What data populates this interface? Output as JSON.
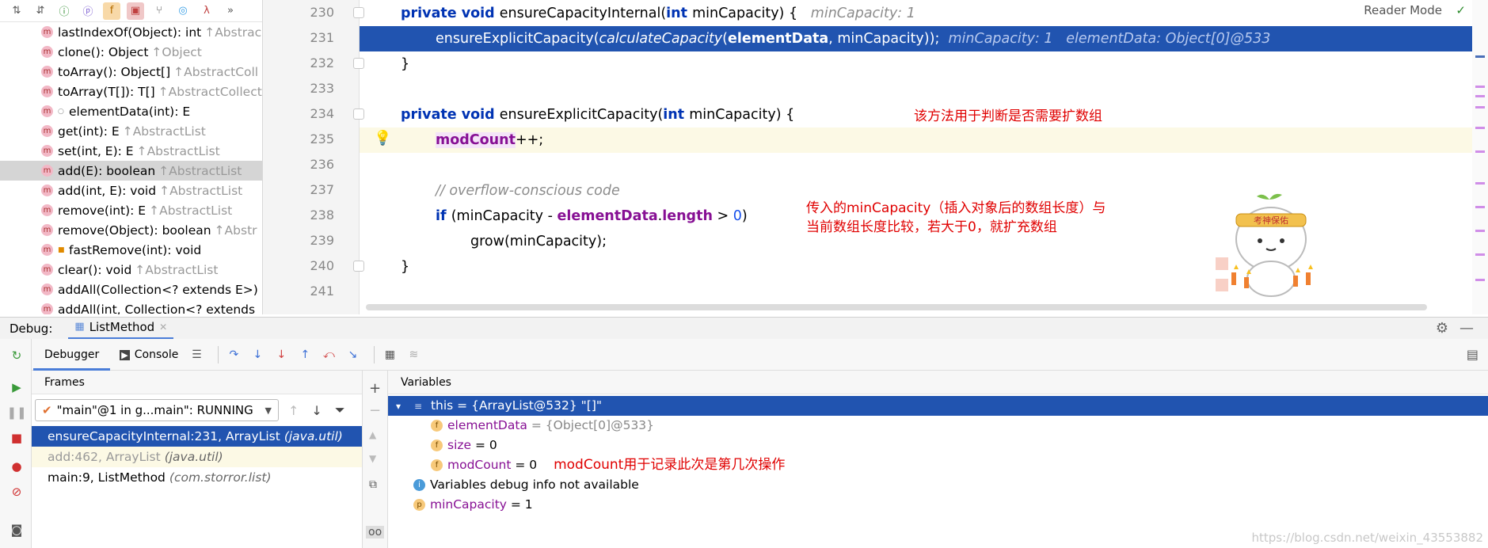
{
  "structure": {
    "items": [
      {
        "name": "lastIndexOf(Object): int",
        "owner": "↑Abstrac",
        "vis": ""
      },
      {
        "name": "clone(): Object",
        "owner": "↑Object",
        "vis": ""
      },
      {
        "name": "toArray(): Object[]",
        "owner": "↑AbstractColl",
        "vis": ""
      },
      {
        "name": "toArray(T[]): T[]",
        "owner": "↑AbstractCollect",
        "vis": ""
      },
      {
        "name": "elementData(int): E",
        "owner": "",
        "vis": "○"
      },
      {
        "name": "get(int): E",
        "owner": "↑AbstractList",
        "vis": ""
      },
      {
        "name": "set(int, E): E",
        "owner": "↑AbstractList",
        "vis": ""
      },
      {
        "name": "add(E): boolean",
        "owner": "↑AbstractList",
        "vis": ""
      },
      {
        "name": "add(int, E): void",
        "owner": "↑AbstractList",
        "vis": ""
      },
      {
        "name": "remove(int): E",
        "owner": "↑AbstractList",
        "vis": ""
      },
      {
        "name": "remove(Object): boolean",
        "owner": "↑Abstr",
        "vis": ""
      },
      {
        "name": "fastRemove(int): void",
        "owner": "",
        "vis": "🔒"
      },
      {
        "name": "clear(): void",
        "owner": "↑AbstractList",
        "vis": ""
      },
      {
        "name": "addAll(Collection<? extends E>)",
        "owner": "",
        "vis": ""
      },
      {
        "name": "addAll(int, Collection<? extends",
        "owner": "",
        "vis": ""
      }
    ]
  },
  "editor": {
    "reader_mode": "Reader Mode",
    "line_numbers": [
      "230",
      "231",
      "232",
      "233",
      "234",
      "235",
      "236",
      "237",
      "238",
      "239",
      "240",
      "241"
    ],
    "l230_hint": "minCapacity: 1",
    "l231_hint1": "minCapacity: 1",
    "l231_hint2": "elementData: Object[0]@533",
    "comment": "// overflow-conscious code",
    "annot1": "该方法用于判断是否需要扩数组",
    "annot2a": "传入的minCapacity（插入对象后的数组长度）与",
    "annot2b": "当前数组长度比较，若大于0，就扩充数组",
    "mascot_text": "考神保佑"
  },
  "debug": {
    "label": "Debug:",
    "tab": "ListMethod",
    "debugger_tab": "Debugger",
    "console_tab": "Console",
    "frames_title": "Frames",
    "variables_title": "Variables",
    "thread": "\"main\"@1 in g...main\": RUNNING",
    "frames": [
      {
        "method": "ensureCapacityInternal:231, ArrayList",
        "pkg": "(java.util)"
      },
      {
        "method": "add:462, ArrayList",
        "pkg": "(java.util)"
      },
      {
        "method": "main:9, ListMethod",
        "pkg": "(com.storror.list)"
      }
    ],
    "vars": {
      "this_label": "this = {ArrayList@532} \"[]\"",
      "elementData_name": "elementData",
      "elementData_val": " = {Object[0]@533}",
      "size_name": "size",
      "size_val": " = 0",
      "modCount_name": "modCount",
      "modCount_val": " = 0",
      "modCount_annot": "modCount用于记录此次是第几次操作",
      "no_info": "Variables debug info not available",
      "minCapacity_name": "minCapacity",
      "minCapacity_val": " = 1"
    },
    "watermark": "https://blog.csdn.net/weixin_43553882"
  }
}
